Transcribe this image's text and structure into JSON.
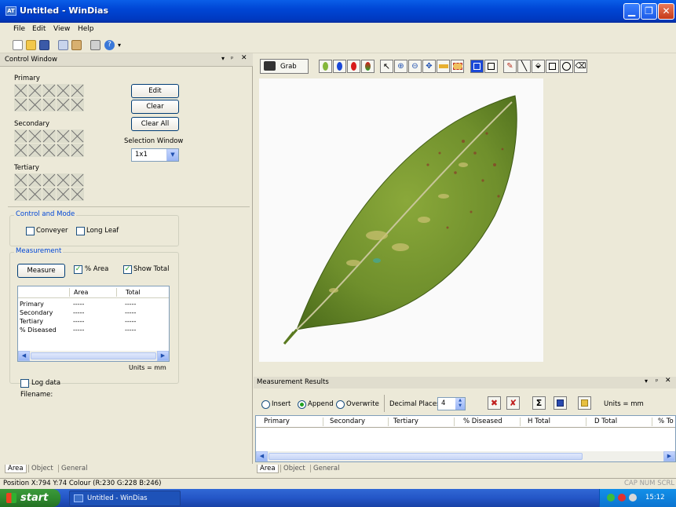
{
  "window": {
    "title": "Untitled - WinDias",
    "app_icon": "AT"
  },
  "menu": {
    "items": [
      "File",
      "Edit",
      "View",
      "Help"
    ]
  },
  "toolbar": {
    "icons": [
      "new-icon",
      "open-icon",
      "save-icon",
      "copy-icon",
      "paste-icon",
      "print-icon",
      "help-icon",
      "overflow-icon"
    ]
  },
  "control_window": {
    "title": "Control Window",
    "primary_label": "Primary",
    "secondary_label": "Secondary",
    "tertiary_label": "Tertiary",
    "edit_button": "Edit",
    "clear_button": "Clear",
    "clear_all_button": "Clear All",
    "selection_window_label": "Selection Window",
    "selection_window_value": "1x1",
    "control_mode": {
      "title": "Control and Mode",
      "conveyer": "Conveyer",
      "long_leaf": "Long Leaf"
    },
    "measurement": {
      "title": "Measurement",
      "measure_button": "Measure",
      "area_pct": "% Area",
      "show_total": "Show Total",
      "col_area": "Area",
      "col_total": "Total",
      "rows": [
        {
          "label": "Primary",
          "area": "-----",
          "total": "-----"
        },
        {
          "label": "Secondary",
          "area": "-----",
          "total": "-----"
        },
        {
          "label": "Tertiary",
          "area": "-----",
          "total": "-----"
        },
        {
          "label": "% Diseased",
          "area": "-----",
          "total": "-----"
        }
      ],
      "units": "Units = mm"
    },
    "log_data": "Log data",
    "filename_label": "Filename:",
    "tabs": [
      "Area",
      "Object",
      "General"
    ]
  },
  "image_toolbar": {
    "grab_label": "Grab"
  },
  "results": {
    "title": "Measurement Results",
    "insert": "Insert",
    "append": "Append",
    "overwrite": "Overwrite",
    "decimal_label": "Decimal Places",
    "decimal_value": "4",
    "units": "Units = mm",
    "columns": [
      "Primary",
      "Secondary",
      "Tertiary",
      "% Diseased",
      "H Total",
      "D Total",
      "% To"
    ],
    "tabs": [
      "Area",
      "Object",
      "General"
    ]
  },
  "status": {
    "text": "Position  X:794 Y:74  Colour (R:230 G:228 B:246)",
    "indicators": "CAP NUM SCRL"
  },
  "taskbar": {
    "start": "start",
    "task": "Untitled - WinDias",
    "clock": "15:12"
  }
}
